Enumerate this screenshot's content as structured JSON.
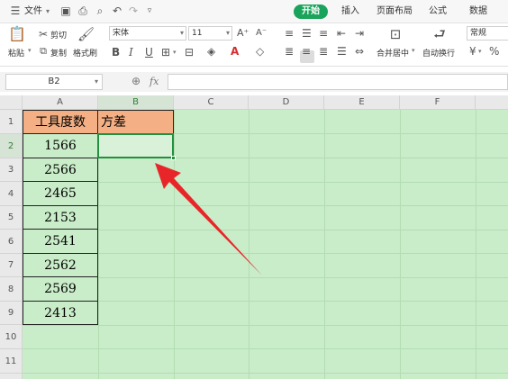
{
  "menubar": {
    "file_label": "文件",
    "tabs": [
      {
        "label": "开始",
        "active": true
      },
      {
        "label": "插入"
      },
      {
        "label": "页面布局"
      },
      {
        "label": "公式"
      },
      {
        "label": "数据"
      }
    ]
  },
  "ribbon": {
    "paste_label": "粘贴",
    "cut_label": "剪切",
    "copy_label": "复制",
    "format_painter_label": "格式刷",
    "font_name": "宋体",
    "font_size": "11",
    "bold": "B",
    "italic": "I",
    "underline": "U",
    "merge_center_label": "合并居中",
    "wrap_text_label": "自动换行",
    "number_format": "常规",
    "percent": "%"
  },
  "formula_bar": {
    "cell_ref": "B2",
    "fx": "fx",
    "formula": ""
  },
  "sheet": {
    "columns": [
      "A",
      "B",
      "C",
      "D",
      "E",
      "F"
    ],
    "rows": [
      "1",
      "2",
      "3",
      "4",
      "5",
      "6",
      "7",
      "8",
      "9",
      "10",
      "11"
    ],
    "header_a": "工具度数",
    "header_b": "方差",
    "values_a": [
      "1566",
      "2566",
      "2465",
      "2153",
      "2541",
      "2562",
      "2569",
      "2413"
    ],
    "selected_cell": "B2"
  },
  "colors": {
    "accent": "#1aa35a",
    "header_fill": "#f4b084",
    "sheet_bg": "#c9ecc9",
    "arrow": "#e8262a"
  }
}
